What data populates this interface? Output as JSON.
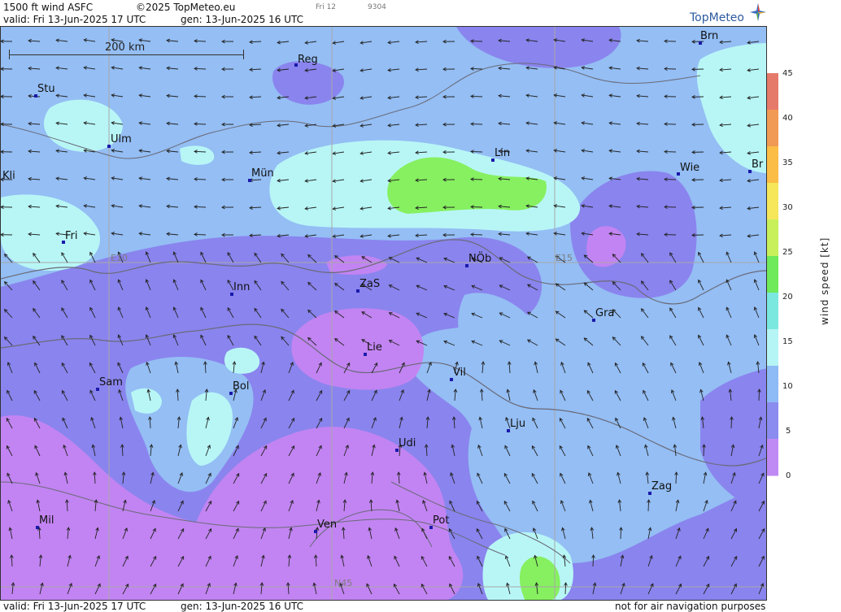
{
  "header": {
    "product": "1500 ft wind ASFC",
    "copyright": "©2025 TopMeteo.eu",
    "day_tab": "Fri 12",
    "code": "9304",
    "valid": "valid:  Fri  13-Jun-2025  17 UTC",
    "gen": "gen: 13-Jun-2025 16 UTC"
  },
  "footer": {
    "valid": "valid:  Fri  13-Jun-2025  17 UTC",
    "gen": "gen: 13-Jun-2025 16 UTC",
    "disclaimer": "not for air navigation purposes"
  },
  "logo": {
    "text": "TopMeteo"
  },
  "scale_bar": {
    "label": "200 km"
  },
  "grid_labels": {
    "e10": "E10",
    "e15": "E15",
    "n45": "N45"
  },
  "cities": [
    {
      "name": "Brn"
    },
    {
      "name": "Reg"
    },
    {
      "name": "Stu"
    },
    {
      "name": "Ulm"
    },
    {
      "name": "Kli"
    },
    {
      "name": "Mün"
    },
    {
      "name": "Lin"
    },
    {
      "name": "Wie"
    },
    {
      "name": "Br"
    },
    {
      "name": "Fri"
    },
    {
      "name": "NÖb"
    },
    {
      "name": "Inn"
    },
    {
      "name": "ZaS"
    },
    {
      "name": "Gra"
    },
    {
      "name": "Lie"
    },
    {
      "name": "Vil"
    },
    {
      "name": "Sam"
    },
    {
      "name": "Bol"
    },
    {
      "name": "Lju"
    },
    {
      "name": "Udi"
    },
    {
      "name": "Zag"
    },
    {
      "name": "Mil"
    },
    {
      "name": "Ven"
    },
    {
      "name": "Pot"
    }
  ],
  "legend": {
    "title": "wind speed [kt]",
    "ticks": [
      "45",
      "40",
      "35",
      "30",
      "25",
      "20",
      "15",
      "10",
      "5",
      "0"
    ],
    "colors": [
      "#e67a6a",
      "#f19a55",
      "#fbbd45",
      "#f5e65a",
      "#c8f05a",
      "#6eea5a",
      "#7be8e0",
      "#b5f5f5",
      "#8ebbf5",
      "#8a8cf0",
      "#c08af5"
    ]
  },
  "map_colors": {
    "violet": "#c284f2",
    "purple": "#8a84ee",
    "blue": "#94bef4",
    "cyan": "#b8f6f6",
    "green": "#86f060"
  }
}
